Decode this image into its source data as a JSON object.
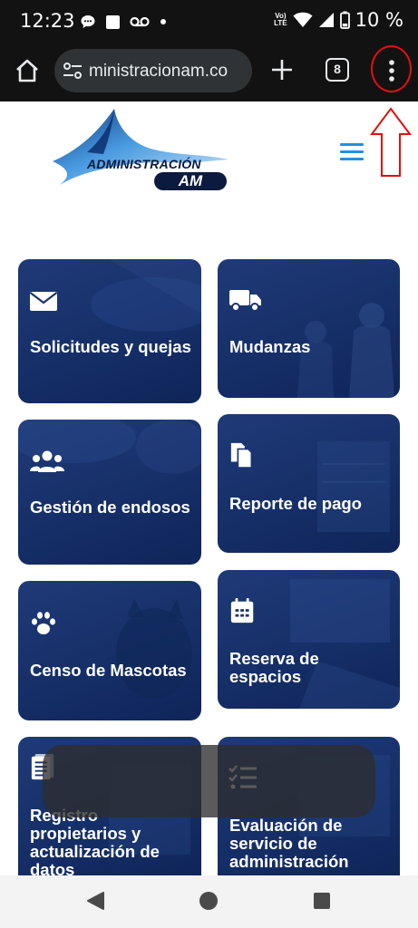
{
  "status_bar": {
    "time": "12:23",
    "network_label_top": "Vo)",
    "network_label_bottom": "LTE",
    "battery": "10 %",
    "icons": [
      "chat-bubble-icon",
      "square-notification-icon",
      "voicemail-icon",
      "dot-icon",
      "volte-icon",
      "wifi-icon",
      "signal-icon",
      "battery-icon"
    ]
  },
  "browser": {
    "url": "ministracionam.co",
    "tab_count": "8",
    "icons": [
      "home-icon",
      "tune-icon",
      "plus-icon",
      "tabs-icon",
      "more-vert-icon"
    ]
  },
  "site": {
    "logo_text": "ADMINISTRACIÓN",
    "logo_am": "AM",
    "brand_color": "#0b1a3e",
    "menu_color": "#2a8de0"
  },
  "cards": [
    {
      "title": "Solicitudes y quejas",
      "icon": "envelope-icon"
    },
    {
      "title": "Mudanzas",
      "icon": "truck-icon"
    },
    {
      "title": "Gestión de endosos",
      "icon": "users-icon"
    },
    {
      "title": "Reporte de pago",
      "icon": "copy-file-icon"
    },
    {
      "title": "Censo de Mascotas",
      "icon": "paw-icon"
    },
    {
      "title": "Reserva de espacios",
      "icon": "calendar-icon"
    },
    {
      "title": "Registro propietarios y actualización de datos",
      "icon": "document-icon"
    },
    {
      "title": "Evaluación de servicio de administración",
      "icon": "checklist-icon"
    }
  ],
  "annotation": {
    "color": "#e01010"
  },
  "nav_bar": {
    "icons": [
      "back-icon",
      "home-circle-icon",
      "recents-icon"
    ]
  }
}
